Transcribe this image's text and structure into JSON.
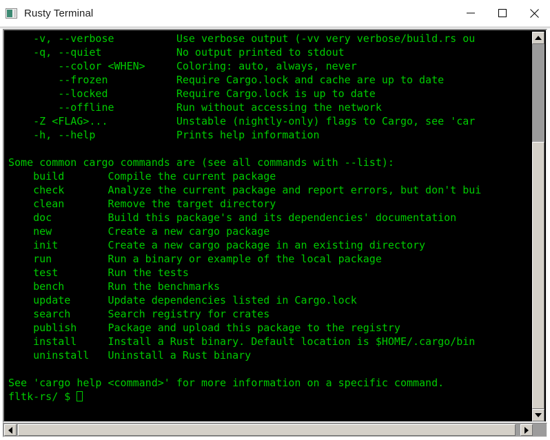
{
  "window": {
    "title": "Rusty Terminal",
    "icon": "terminal-app-icon",
    "minimize_label": "—",
    "maximize_label": "□",
    "close_label": "✕"
  },
  "terminal": {
    "foreground_color": "#00cc00",
    "background_color": "#000000",
    "prompt": "fltk-rs/ $ ",
    "cursor": "block-cursor",
    "lines": [
      "    -v, --verbose          Use verbose output (-vv very verbose/build.rs ou",
      "    -q, --quiet            No output printed to stdout",
      "        --color <WHEN>     Coloring: auto, always, never",
      "        --frozen           Require Cargo.lock and cache are up to date",
      "        --locked           Require Cargo.lock is up to date",
      "        --offline          Run without accessing the network",
      "    -Z <FLAG>...           Unstable (nightly-only) flags to Cargo, see 'car",
      "    -h, --help             Prints help information",
      "",
      "Some common cargo commands are (see all commands with --list):",
      "    build       Compile the current package",
      "    check       Analyze the current package and report errors, but don't bui",
      "    clean       Remove the target directory",
      "    doc         Build this package's and its dependencies' documentation",
      "    new         Create a new cargo package",
      "    init        Create a new cargo package in an existing directory",
      "    run         Run a binary or example of the local package",
      "    test        Run the tests",
      "    bench       Run the benchmarks",
      "    update      Update dependencies listed in Cargo.lock",
      "    search      Search registry for crates",
      "    publish     Package and upload this package to the registry",
      "    install     Install a Rust binary. Default location is $HOME/.cargo/bin",
      "    uninstall   Uninstall a Rust binary",
      "",
      "See 'cargo help <command>' for more information on a specific command."
    ]
  },
  "scrollbars": {
    "vertical": {
      "up_arrow": "scroll-up-arrow",
      "down_arrow": "scroll-down-arrow",
      "thumb": "vertical-scroll-thumb"
    },
    "horizontal": {
      "left_arrow": "scroll-left-arrow",
      "right_arrow": "scroll-right-arrow",
      "thumb": "horizontal-scroll-thumb"
    }
  }
}
